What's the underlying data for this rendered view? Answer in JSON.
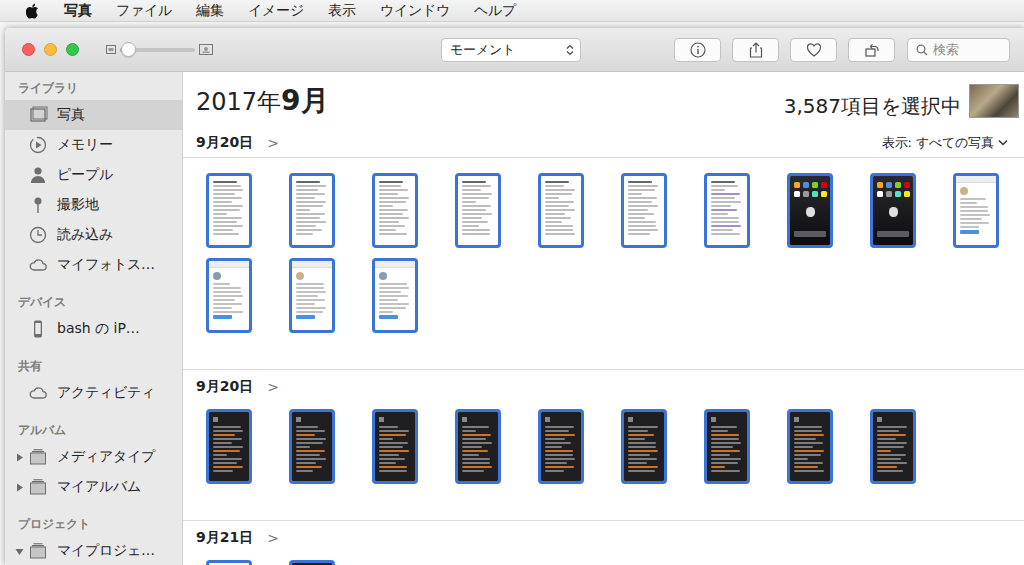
{
  "menu_bar": {
    "items": [
      {
        "label": "写真",
        "bold": true
      },
      {
        "label": "ファイル",
        "bold": false
      },
      {
        "label": "編集",
        "bold": false
      },
      {
        "label": "イメージ",
        "bold": false
      },
      {
        "label": "表示",
        "bold": false
      },
      {
        "label": "ウインドウ",
        "bold": false
      },
      {
        "label": "ヘルプ",
        "bold": false
      }
    ]
  },
  "toolbar": {
    "zoom": {
      "level": 0.1
    },
    "view": {
      "label": "モーメント"
    },
    "search": {
      "placeholder": "検索"
    }
  },
  "sidebar": {
    "sections": [
      {
        "title": "ライブラリ",
        "items": [
          {
            "label": "写真",
            "selected": true
          },
          {
            "label": "メモリー",
            "selected": false
          },
          {
            "label": "ピープル",
            "selected": false
          },
          {
            "label": "撮影地",
            "selected": false
          },
          {
            "label": "読み込み",
            "selected": false
          },
          {
            "label": "マイフォトス…",
            "selected": false
          }
        ]
      },
      {
        "title": "デバイス",
        "items": [
          {
            "label": "bash の iP…",
            "selected": false
          }
        ]
      },
      {
        "title": "共有",
        "items": [
          {
            "label": "アクティビティ",
            "selected": false
          }
        ]
      },
      {
        "title": "アルバム",
        "items": [
          {
            "label": "メディアタイプ",
            "selected": false,
            "expanded": false
          },
          {
            "label": "マイアルバム",
            "selected": false,
            "expanded": false
          }
        ]
      },
      {
        "title": "プロジェクト",
        "items": [
          {
            "label": "マイプロジェ…",
            "selected": false,
            "expanded": true
          }
        ]
      }
    ]
  },
  "header": {
    "year": "2017年",
    "month": "9月",
    "selection": "3,587項目を選択中"
  },
  "moments": [
    {
      "date": "9月20日",
      "chevron": ">",
      "filter": {
        "label": "表示:",
        "value": "すべての写真"
      },
      "items": [
        {
          "kind": "doc",
          "selected": true
        },
        {
          "kind": "doc",
          "selected": true
        },
        {
          "kind": "doc",
          "selected": true
        },
        {
          "kind": "doc",
          "selected": true
        },
        {
          "kind": "doc",
          "selected": true
        },
        {
          "kind": "doc",
          "selected": true
        },
        {
          "kind": "doc",
          "selected": true
        },
        {
          "kind": "home",
          "selected": true
        },
        {
          "kind": "home",
          "selected": true
        },
        {
          "kind": "social",
          "selected": true
        },
        {
          "kind": "social",
          "selected": true
        },
        {
          "kind": "social",
          "selected": true
        },
        {
          "kind": "social",
          "selected": true
        }
      ]
    },
    {
      "date": "9月20日",
      "chevron": ">",
      "items": [
        {
          "kind": "dark",
          "selected": true
        },
        {
          "kind": "dark",
          "selected": true
        },
        {
          "kind": "dark",
          "selected": true
        },
        {
          "kind": "dark",
          "selected": true
        },
        {
          "kind": "dark",
          "selected": true
        },
        {
          "kind": "dark",
          "selected": true
        },
        {
          "kind": "dark",
          "selected": true
        },
        {
          "kind": "dark",
          "selected": true
        },
        {
          "kind": "dark",
          "selected": true
        }
      ]
    },
    {
      "date": "9月21日",
      "chevron": ">",
      "items": [
        {
          "kind": "doc",
          "selected": true
        },
        {
          "kind": "dark",
          "selected": true
        }
      ]
    }
  ]
}
